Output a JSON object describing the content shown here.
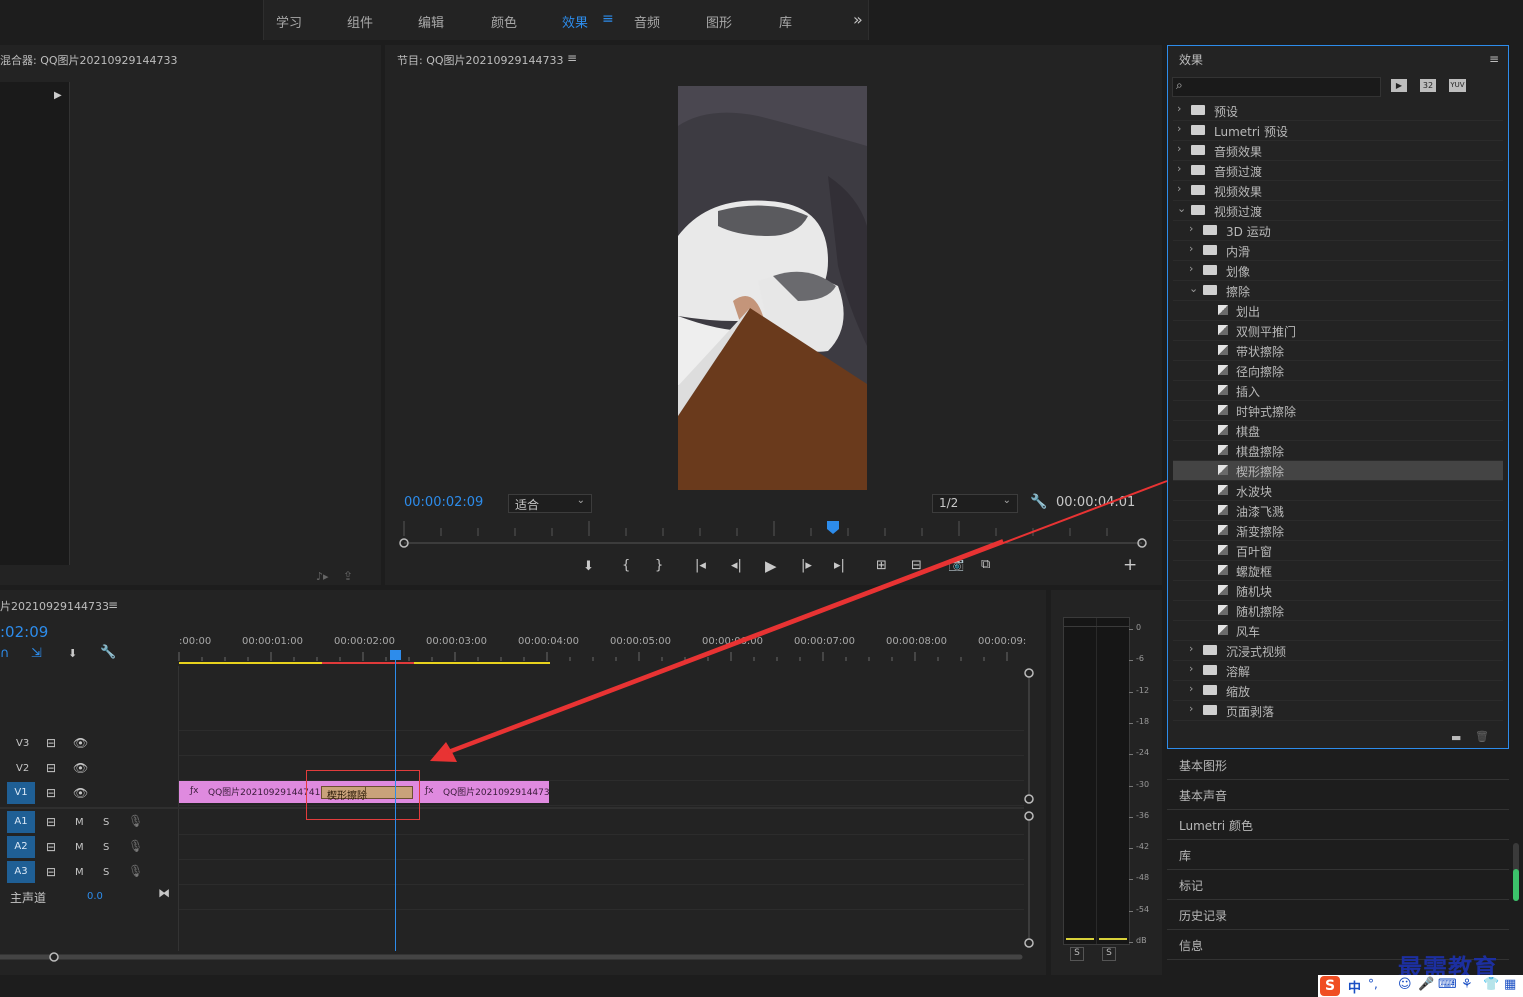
{
  "workspaces": [
    {
      "label": "学习"
    },
    {
      "label": "组件"
    },
    {
      "label": "编辑"
    },
    {
      "label": "颜色"
    },
    {
      "label": "效果",
      "active": true
    },
    {
      "label": "音频"
    },
    {
      "label": "图形"
    },
    {
      "label": "库"
    }
  ],
  "workspace_more": "»",
  "source": {
    "title": "混合器: QQ图片20210929144733"
  },
  "program": {
    "title": "节目: QQ图片20210929144733",
    "timecode_current": "00:00:02:09",
    "fit_label": "适合",
    "quality_label": "1/2",
    "timecode_duration": "00:00:04:01",
    "add_button": "+"
  },
  "timeline": {
    "title": "片20210929144733",
    "timecode": ":02:09",
    "ruler_labels": [
      ":00:00",
      "00:00:01:00",
      "00:00:02:00",
      "00:00:03:00",
      "00:00:04:00",
      "00:00:05:00",
      "00:00:06:00",
      "00:00:07:00",
      "00:00:08:00",
      "00:00:09:"
    ],
    "video_tracks": [
      {
        "name": "V3"
      },
      {
        "name": "V2"
      },
      {
        "name": "V1"
      }
    ],
    "audio_tracks": [
      {
        "name": "A1",
        "m": "M",
        "s": "S"
      },
      {
        "name": "A2",
        "m": "M",
        "s": "S"
      },
      {
        "name": "A3",
        "m": "M",
        "s": "S"
      }
    ],
    "master_label": "主声道",
    "master_value": "0.0",
    "clip1_label": "QQ图片20210929144741.",
    "transition_label": "楔形擦除",
    "clip2_label": "QQ图片2021092914473"
  },
  "meter": {
    "scale": [
      "0",
      "-6",
      "-12",
      "-18",
      "-24",
      "-30",
      "-36",
      "-42",
      "-48",
      "-54",
      "dB"
    ],
    "solo": [
      "S",
      "S"
    ]
  },
  "effects": {
    "title": "效果",
    "tool_labels": [
      "32",
      "YUV"
    ],
    "tree": [
      {
        "label": "预设",
        "level": 0,
        "type": "folder",
        "state": "closed"
      },
      {
        "label": "Lumetri 预设",
        "level": 0,
        "type": "folder",
        "state": "closed"
      },
      {
        "label": "音频效果",
        "level": 0,
        "type": "folder",
        "state": "closed"
      },
      {
        "label": "音频过渡",
        "level": 0,
        "type": "folder",
        "state": "closed"
      },
      {
        "label": "视频效果",
        "level": 0,
        "type": "folder",
        "state": "closed"
      },
      {
        "label": "视频过渡",
        "level": 0,
        "type": "folder",
        "state": "open"
      },
      {
        "label": "3D 运动",
        "level": 1,
        "type": "folder",
        "state": "closed"
      },
      {
        "label": "内滑",
        "level": 1,
        "type": "folder",
        "state": "closed"
      },
      {
        "label": "划像",
        "level": 1,
        "type": "folder",
        "state": "closed"
      },
      {
        "label": "擦除",
        "level": 1,
        "type": "folder",
        "state": "open"
      },
      {
        "label": "划出",
        "level": 2,
        "type": "effect"
      },
      {
        "label": "双侧平推门",
        "level": 2,
        "type": "effect"
      },
      {
        "label": "带状擦除",
        "level": 2,
        "type": "effect"
      },
      {
        "label": "径向擦除",
        "level": 2,
        "type": "effect"
      },
      {
        "label": "插入",
        "level": 2,
        "type": "effect"
      },
      {
        "label": "时钟式擦除",
        "level": 2,
        "type": "effect"
      },
      {
        "label": "棋盘",
        "level": 2,
        "type": "effect"
      },
      {
        "label": "棋盘擦除",
        "level": 2,
        "type": "effect"
      },
      {
        "label": "楔形擦除",
        "level": 2,
        "type": "effect",
        "selected": true
      },
      {
        "label": "水波块",
        "level": 2,
        "type": "effect"
      },
      {
        "label": "油漆飞溅",
        "level": 2,
        "type": "effect"
      },
      {
        "label": "渐变擦除",
        "level": 2,
        "type": "effect"
      },
      {
        "label": "百叶窗",
        "level": 2,
        "type": "effect"
      },
      {
        "label": "螺旋框",
        "level": 2,
        "type": "effect"
      },
      {
        "label": "随机块",
        "level": 2,
        "type": "effect"
      },
      {
        "label": "随机擦除",
        "level": 2,
        "type": "effect"
      },
      {
        "label": "风车",
        "level": 2,
        "type": "effect"
      },
      {
        "label": "沉浸式视频",
        "level": 1,
        "type": "folder",
        "state": "closed"
      },
      {
        "label": "溶解",
        "level": 1,
        "type": "folder",
        "state": "closed"
      },
      {
        "label": "缩放",
        "level": 1,
        "type": "folder",
        "state": "closed"
      },
      {
        "label": "页面剥落",
        "level": 1,
        "type": "folder",
        "state": "closed"
      }
    ]
  },
  "side_panels": [
    "基本图形",
    "基本声音",
    "Lumetri 颜色",
    "库",
    "标记",
    "历史记录",
    "信息"
  ],
  "watermark": "最需教育",
  "ime": {
    "lang": "中",
    "punct": "°,"
  },
  "colors": {
    "accent": "#2d8ceb",
    "clip": "#df8adf",
    "transition": "#c9a27a",
    "arrow": "#e83333"
  }
}
